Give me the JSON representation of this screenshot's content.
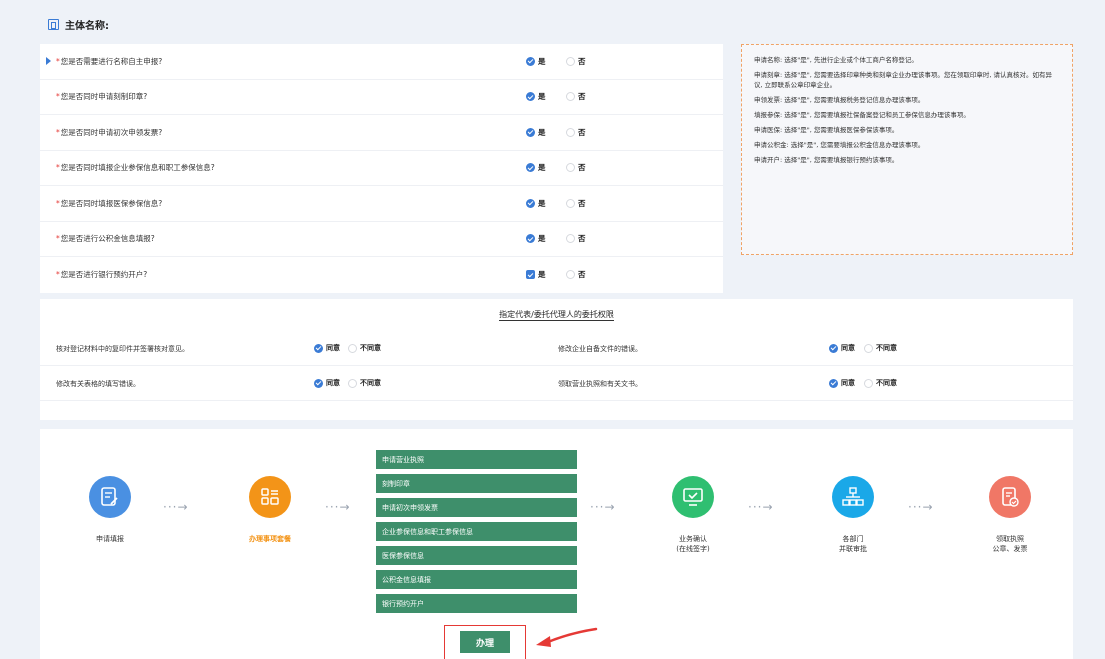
{
  "header": {
    "title": "主体名称:"
  },
  "questions": [
    {
      "label": "您是否需要进行名称自主申报?",
      "yes": "是",
      "no": "否"
    },
    {
      "label": "您是否同时申请刻制印章?",
      "yes": "是",
      "no": "否"
    },
    {
      "label": "您是否同时申请初次申领发票?",
      "yes": "是",
      "no": "否"
    },
    {
      "label": "您是否同时填报企业参保信息和职工参保信息?",
      "yes": "是",
      "no": "否"
    },
    {
      "label": "您是否同时填报医保参保信息?",
      "yes": "是",
      "no": "否"
    },
    {
      "label": "您是否进行公积金信息填报?",
      "yes": "是",
      "no": "否"
    },
    {
      "label": "您是否进行银行预约开户?",
      "yes": "是",
      "no": "否"
    }
  ],
  "required_mark": "*",
  "notes": [
    "申请名称: 选择\"是\", 先进行企业或个体工商户名称登记。",
    "申请刻章: 选择\"是\", 您需要选择印章种类和刻章企业办理该事项。您在领取印章时, 请认真核对。如有异议, 立即联系公章印章企业。",
    "申领发票: 选择\"是\", 您需要填报税务登记信息办理该事项。",
    "填报参保: 选择\"是\", 您需要填报社保备案登记和员工参保信息办理该事项。",
    "申请医保: 选择\"是\", 您需要填报医保参保该事项。",
    "申请公积金: 选择\"是\", 您需要填报公积金信息办理该事项。",
    "申请开户: 选择\"是\", 您需要填报银行预约该事项。"
  ],
  "delegate": {
    "title": "指定代表/委托代理人的委托权限",
    "rows": [
      [
        {
          "label": "核对登记材料中的复印件并签署核对意见。",
          "agree": "同意",
          "disagree": "不同意"
        },
        {
          "label": "修改企业自备文件的错误。",
          "agree": "同意",
          "disagree": "不同意"
        }
      ],
      [
        {
          "label": "修改有关表格的填写错误。",
          "agree": "同意",
          "disagree": "不同意"
        },
        {
          "label": "领取营业执照和有关文书。",
          "agree": "同意",
          "disagree": "不同意"
        }
      ]
    ]
  },
  "flow": {
    "steps": [
      {
        "label": "申请填报",
        "color": "#4a90e2",
        "icon": "form-edit-icon"
      },
      {
        "label": "办理事项套餐",
        "color": "#f39418",
        "icon": "package-icon"
      },
      {
        "label": "业务确认\n(在线签字)",
        "color": "#2fbf71",
        "icon": "monitor-check-icon"
      },
      {
        "label": "各部门\n并联审批",
        "color": "#1aa8e8",
        "icon": "org-chart-icon"
      },
      {
        "label": "领取执照\n公章、发票",
        "color": "#f07766",
        "icon": "document-check-icon"
      }
    ],
    "arrow": "···→",
    "items": [
      "申请营业执照",
      "刻制印章",
      "申请初次申领发票",
      "企业参保信息和职工参保信息",
      "医保参保信息",
      "公积金信息填报",
      "银行预约开户"
    ],
    "process_button": "办理"
  },
  "colors": {
    "accent": "#3a7bd5",
    "green": "#3e8f6b",
    "orange": "#f39418",
    "red": "#e53935"
  }
}
